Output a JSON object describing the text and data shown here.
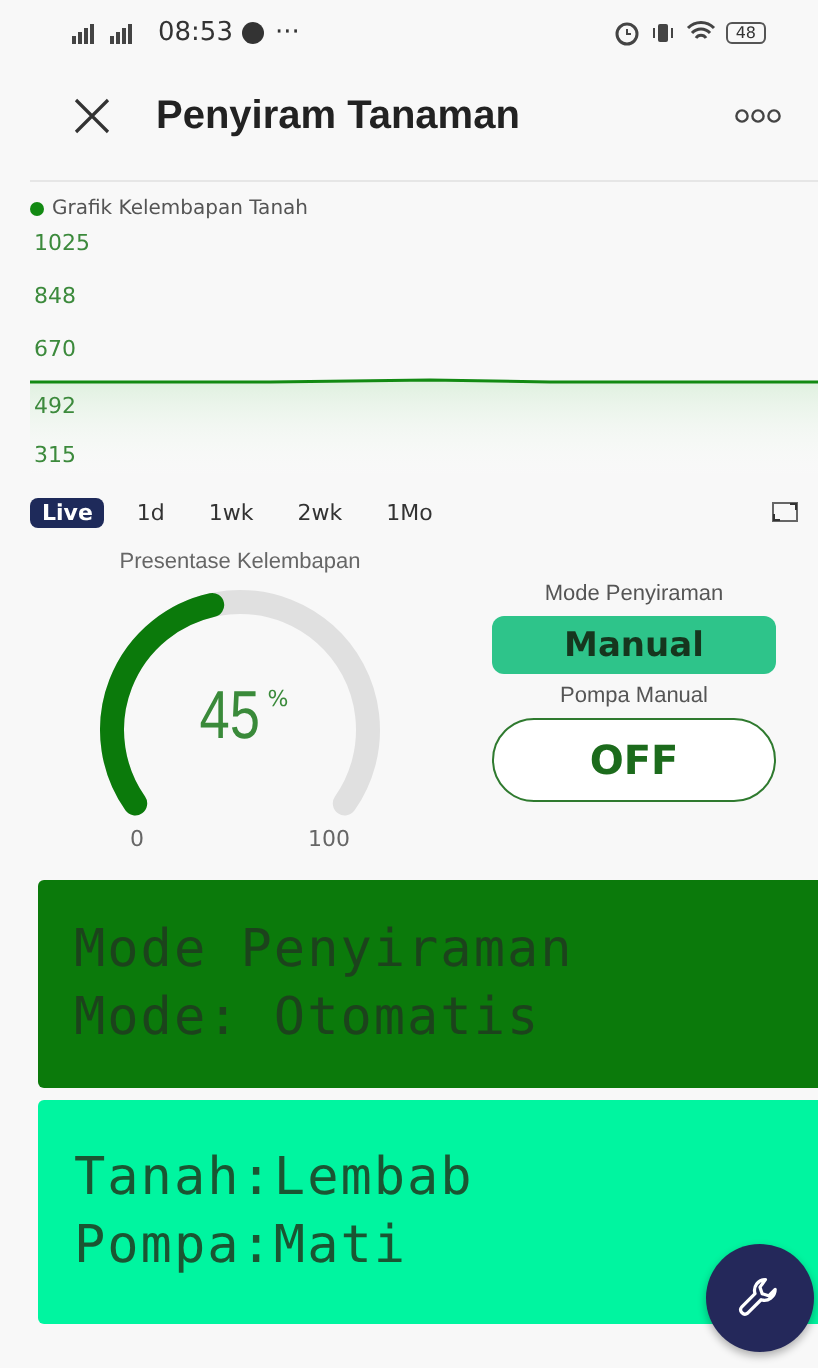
{
  "status_bar": {
    "time": "08:53",
    "dots": "···",
    "battery": "48"
  },
  "header": {
    "title": "Penyiram Tanaman"
  },
  "chart": {
    "legend": {
      "label": "Grafik Kelembapan Tanah",
      "color": "#138a13"
    },
    "y_ticks": [
      "1025",
      "848",
      "670",
      "492",
      "315"
    ],
    "ranges": [
      {
        "label": "Live",
        "selected": true
      },
      {
        "label": "1d",
        "selected": false
      },
      {
        "label": "1wk",
        "selected": false
      },
      {
        "label": "2wk",
        "selected": false
      },
      {
        "label": "1Mo",
        "selected": false
      }
    ]
  },
  "gauge": {
    "title": "Presentase Kelembapan",
    "value": "45",
    "unit": "%",
    "min": "0",
    "max": "100"
  },
  "mode": {
    "label": "Mode Penyiraman",
    "value": "Manual"
  },
  "pump": {
    "label": "Pompa Manual",
    "value": "OFF",
    "on": false
  },
  "lcds": [
    {
      "lines": [
        "Mode Penyiraman",
        "Mode: Otomatis"
      ],
      "color": "#0b7a0b"
    },
    {
      "lines": [
        "Tanah:Lembab",
        "Pompa:Mati"
      ],
      "color": "#00f5a0"
    }
  ]
}
